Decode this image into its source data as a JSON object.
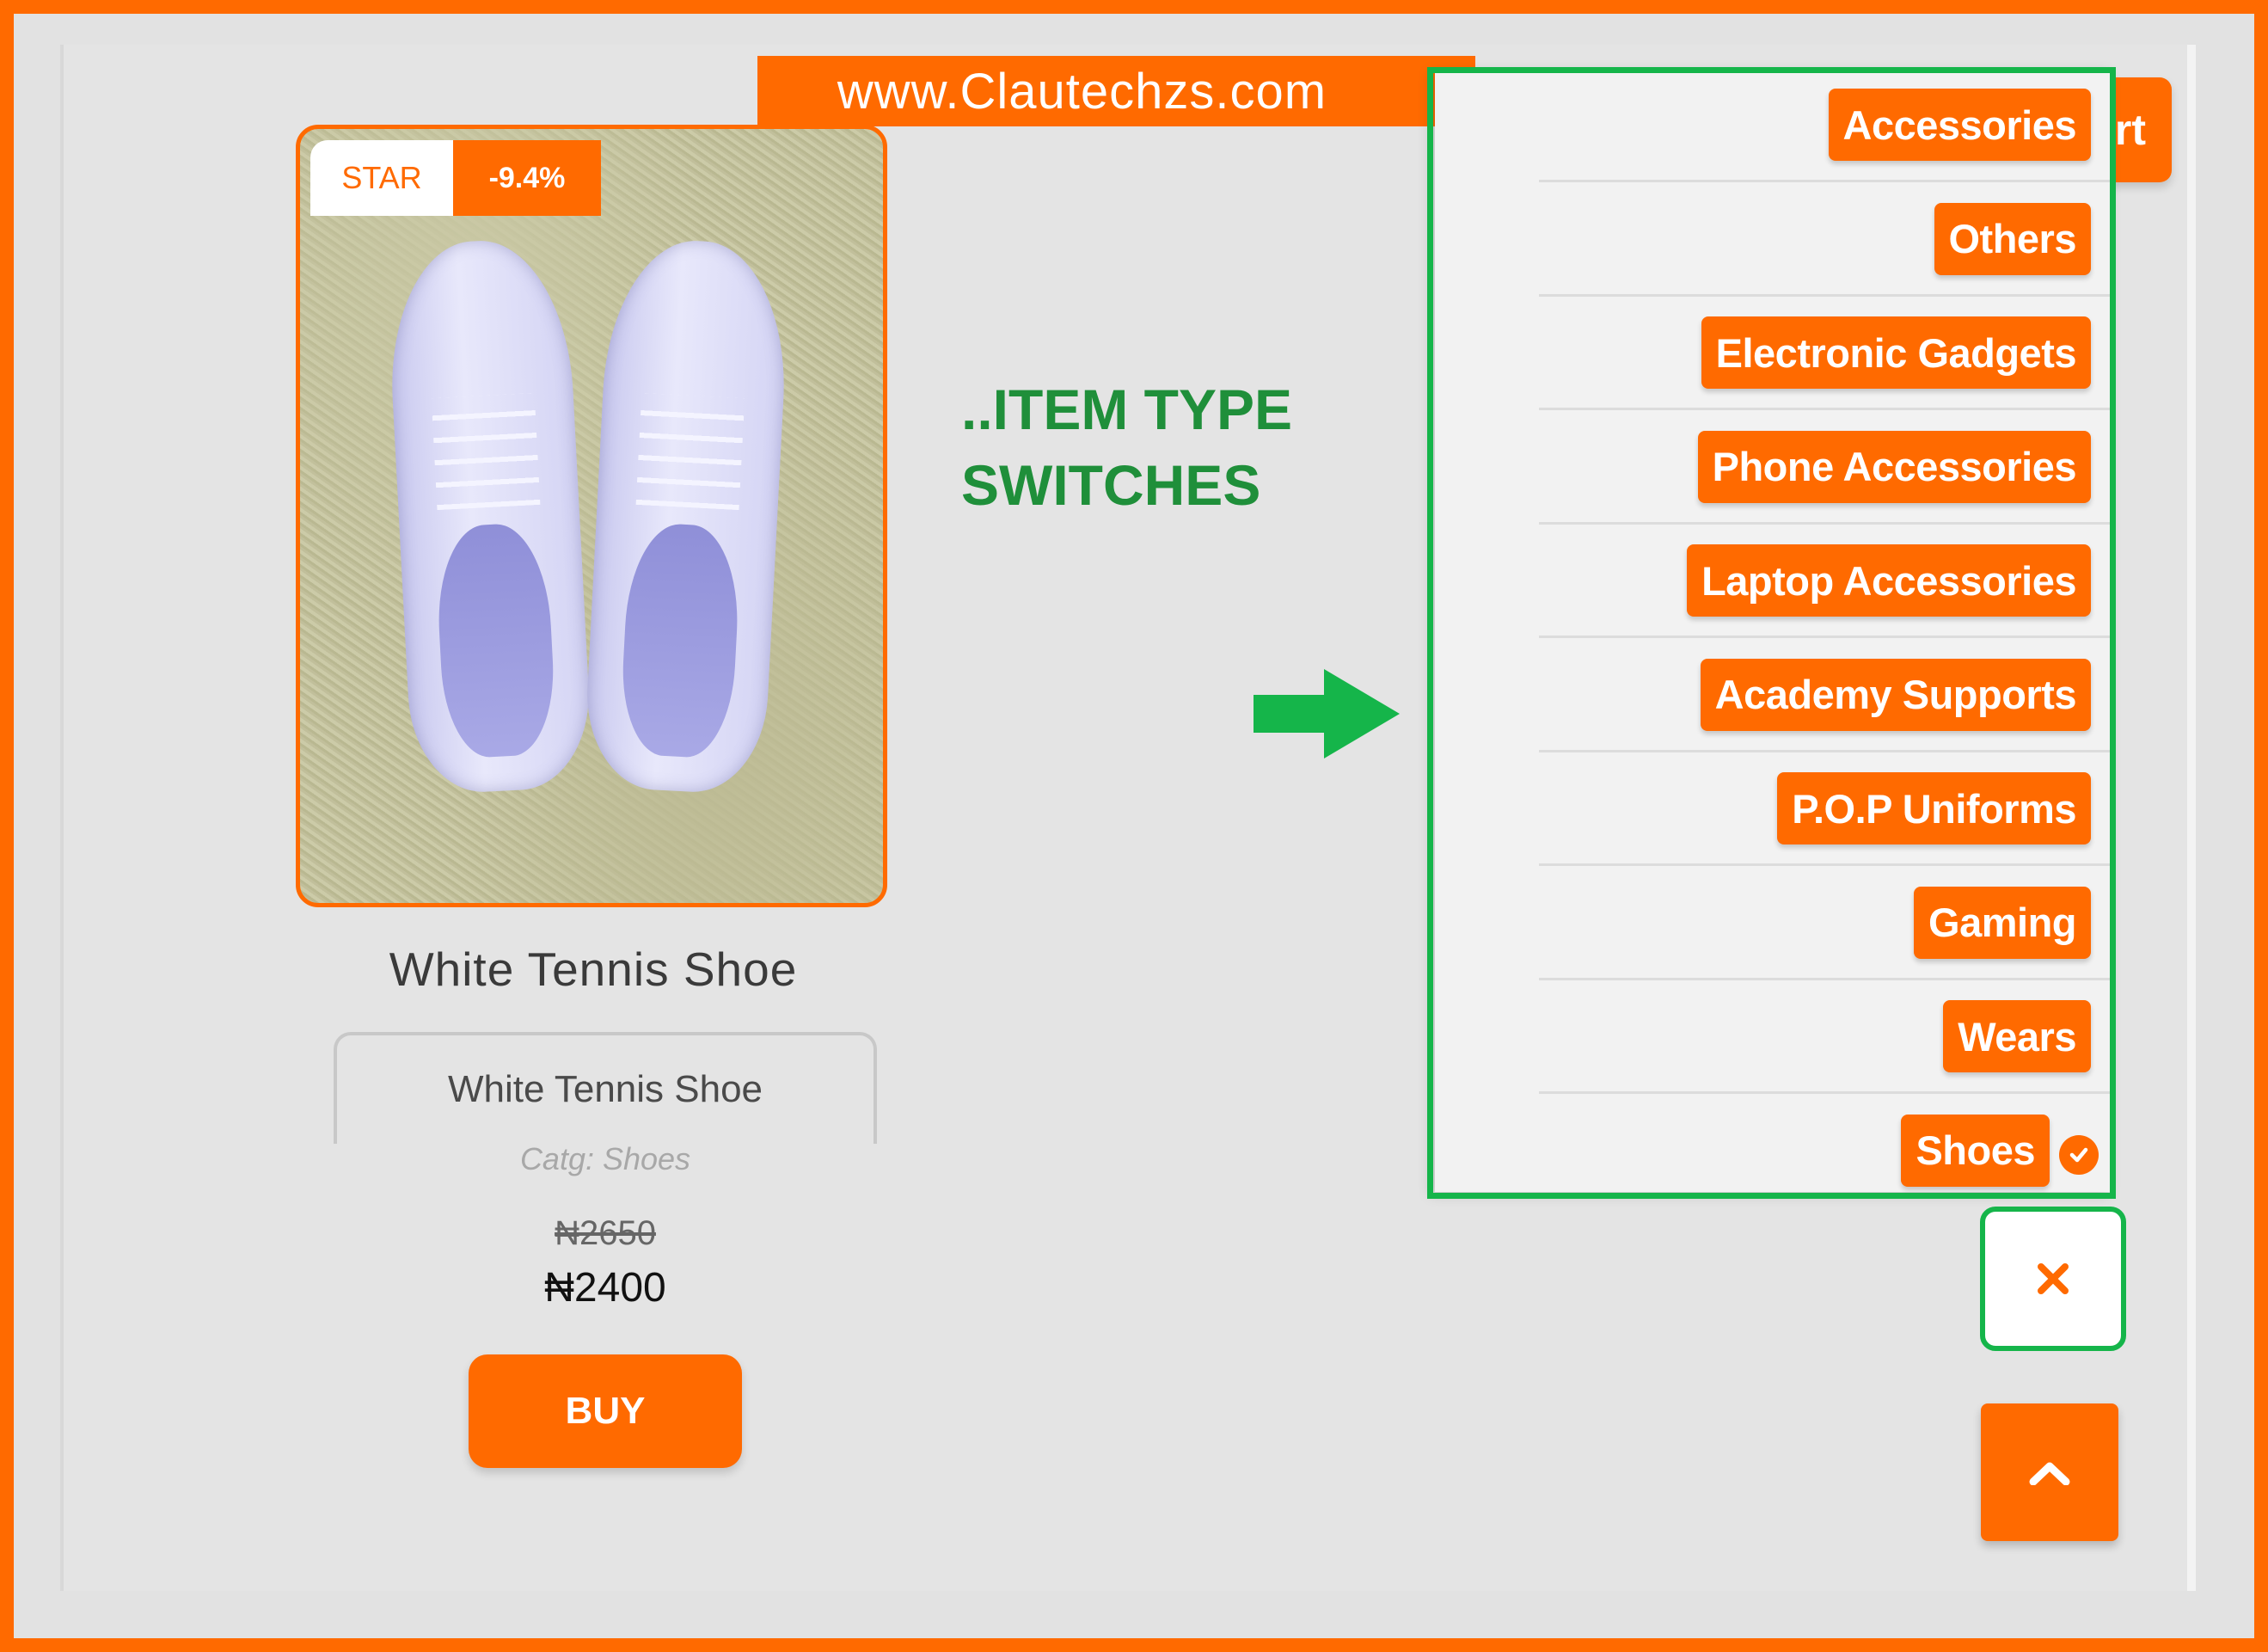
{
  "banner": {
    "site_url": "www.Clautechzs.com"
  },
  "product": {
    "badge_label": "STAR",
    "discount": "-9.4%",
    "title": "White Tennis Shoe",
    "variant_value": "White Tennis Shoe",
    "category": "Catg: Shoes",
    "old_price": "₦2650",
    "price": "₦2400",
    "buy_label": "BUY"
  },
  "annotation": {
    "line1": "..ITEM TYPE",
    "line2": "SWITCHES",
    "color": "#1f8f3a",
    "arrow_color": "#15b54a"
  },
  "cart_button": {
    "label_fragment": "rt"
  },
  "categories": {
    "items": [
      "Accessories",
      "Others",
      "Electronic Gadgets",
      "Phone Accessories",
      "Laptop Accessories",
      "Academy Supports",
      "P.O.P Uniforms",
      "Gaming",
      "Wears",
      "Shoes"
    ],
    "selected": "Shoes"
  },
  "icons": {
    "close": "close-icon",
    "scroll_top": "chevron-up-icon",
    "selected": "check-circle-icon",
    "arrow": "arrow-right-icon"
  },
  "colors": {
    "accent": "#ff6a00",
    "highlight": "#15b54a",
    "background": "#e2e2e2"
  }
}
